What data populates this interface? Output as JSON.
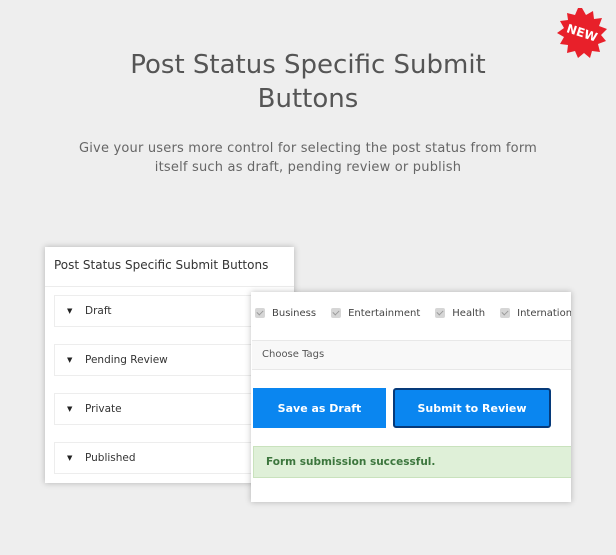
{
  "badge": {
    "text": "NEW",
    "color": "#e8202a"
  },
  "header": {
    "title_line1": "Post Status Specific Submit",
    "title_line2": "Buttons",
    "subtitle_line1": "Give your users more control for selecting the post status from  form",
    "subtitle_line2": "itself such as draft, pending review or publish"
  },
  "left_panel": {
    "title": "Post Status Specific Submit Buttons",
    "items": [
      {
        "label": "Draft",
        "icon": "caret-down-icon"
      },
      {
        "label": "Pending Review",
        "icon": "caret-down-icon"
      },
      {
        "label": "Private",
        "icon": "caret-down-icon"
      },
      {
        "label": "Published",
        "icon": "caret-down-icon"
      }
    ]
  },
  "right_panel": {
    "categories": [
      {
        "label": "Business",
        "checked": true
      },
      {
        "label": "Entertainment",
        "checked": true
      },
      {
        "label": "Health",
        "checked": true
      },
      {
        "label": "International",
        "checked": true
      }
    ],
    "tags_placeholder": "Choose Tags",
    "draft_button": "Save as Draft",
    "review_button": "Submit to Review",
    "success_message": "Form submission successful.",
    "colors": {
      "button": "#0a86f0",
      "success_bg": "#dff0d8",
      "success_text": "#3c763d"
    }
  }
}
